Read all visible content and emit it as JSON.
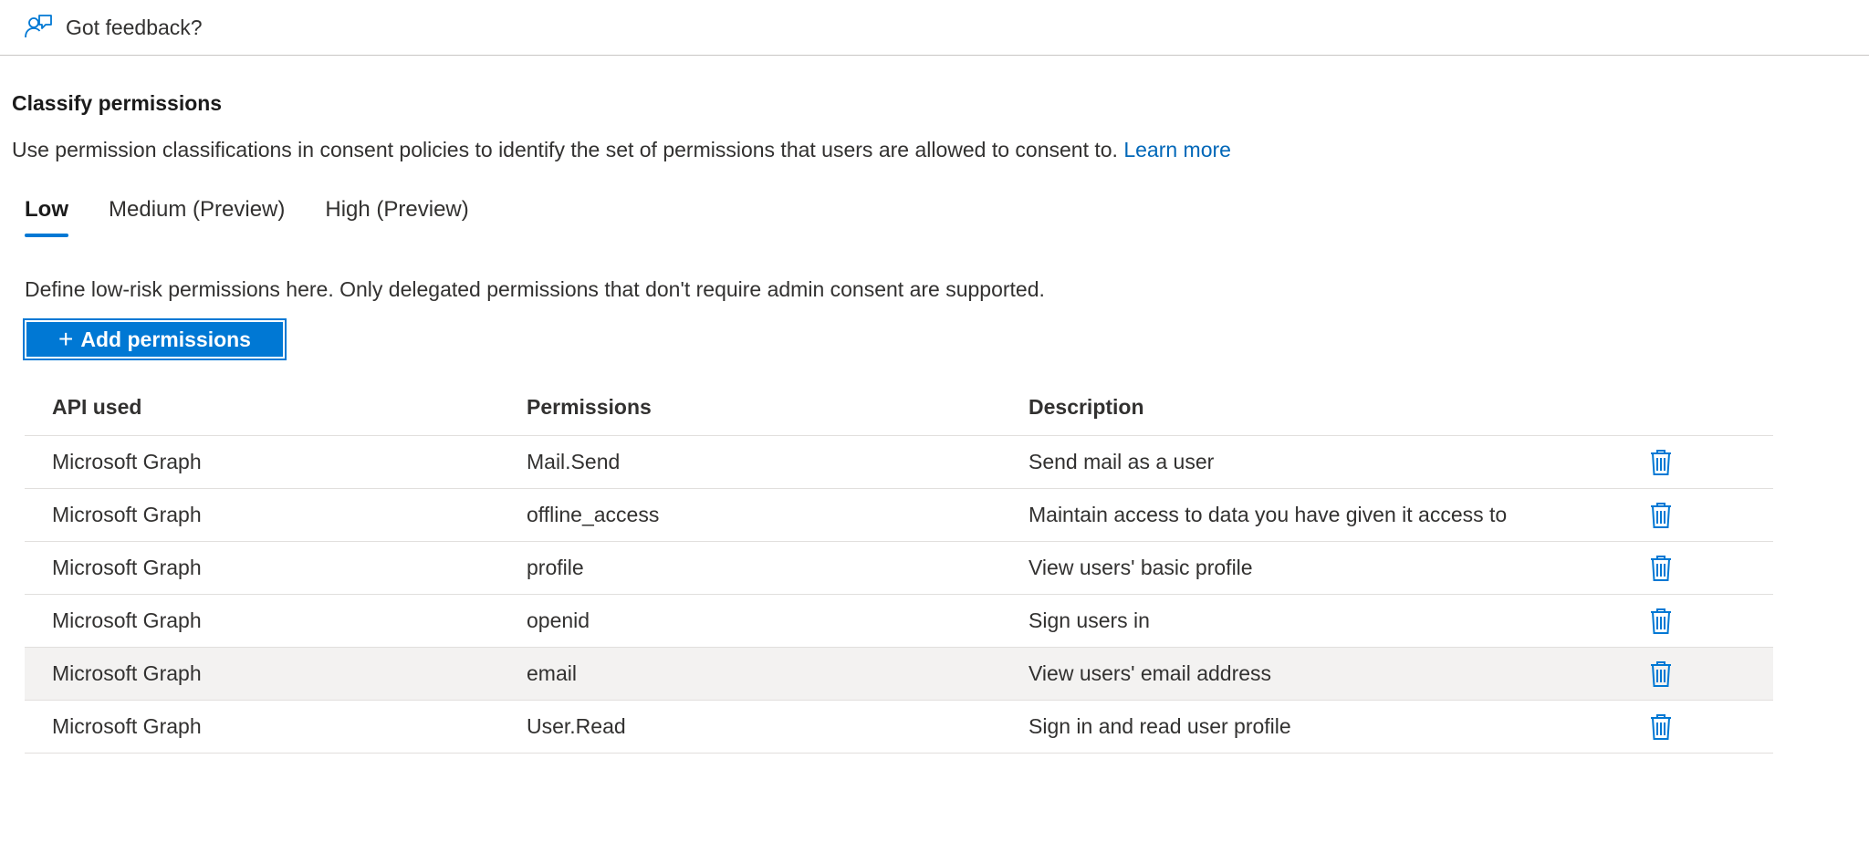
{
  "feedback": {
    "label": "Got feedback?"
  },
  "section": {
    "title": "Classify permissions",
    "description": "Use permission classifications in consent policies to identify the set of permissions that users are allowed to consent to.",
    "learn_more": "Learn more"
  },
  "tabs": [
    {
      "label": "Low",
      "active": true
    },
    {
      "label": "Medium (Preview)",
      "active": false
    },
    {
      "label": "High (Preview)",
      "active": false
    }
  ],
  "tab_description": "Define low-risk permissions here. Only delegated permissions that don't require admin consent are supported.",
  "add_button": {
    "label": "Add permissions",
    "icon": "plus-icon"
  },
  "table": {
    "headers": {
      "api": "API used",
      "permissions": "Permissions",
      "description": "Description"
    },
    "rows": [
      {
        "api": "Microsoft Graph",
        "permission": "Mail.Send",
        "description": "Send mail as a user"
      },
      {
        "api": "Microsoft Graph",
        "permission": "offline_access",
        "description": "Maintain access to data you have given it access to"
      },
      {
        "api": "Microsoft Graph",
        "permission": "profile",
        "description": "View users' basic profile"
      },
      {
        "api": "Microsoft Graph",
        "permission": "openid",
        "description": "Sign users in"
      },
      {
        "api": "Microsoft Graph",
        "permission": "email",
        "description": "View users' email address"
      },
      {
        "api": "Microsoft Graph",
        "permission": "User.Read",
        "description": "Sign in and read user profile"
      }
    ],
    "highlighted_row_index": 4,
    "row_action_icon": "trash-icon"
  },
  "colors": {
    "accent": "#0078d4",
    "link": "#0067b8",
    "row_highlight": "#f3f2f1"
  }
}
